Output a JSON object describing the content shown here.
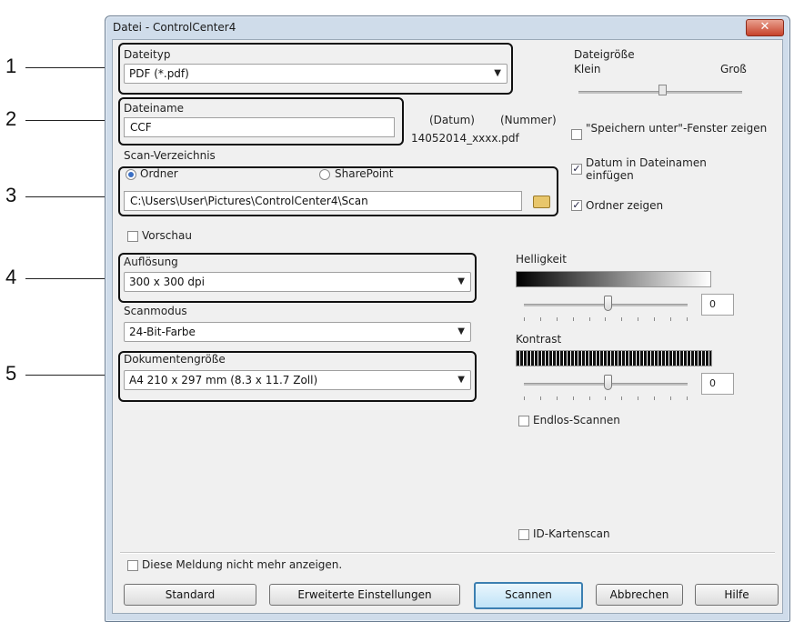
{
  "callouts": [
    "1",
    "2",
    "3",
    "4",
    "5"
  ],
  "window": {
    "title": "Datei - ControlCenter4",
    "close_glyph": "✕"
  },
  "file_type": {
    "label": "Dateityp",
    "value": "PDF (*.pdf)"
  },
  "file_size": {
    "label": "Dateigröße",
    "min_label": "Klein",
    "max_label": "Groß",
    "level": 0.6
  },
  "file_name": {
    "label": "Dateiname",
    "value": "CCF",
    "date_label": "(Datum)",
    "number_label": "(Nummer)",
    "example": "14052014_xxxx.pdf"
  },
  "scan_dir": {
    "label": "Scan-Verzeichnis",
    "folder_option": "Ordner",
    "sharepoint_option": "SharePoint",
    "path": "C:\\Users\\User\\Pictures\\ControlCenter4\\Scan"
  },
  "options": {
    "save_as": "\"Speichern unter\"-Fenster zeigen",
    "date_in_name": "Datum in Dateinamen einfügen",
    "show_folder": "Ordner zeigen"
  },
  "preview": {
    "label": "Vorschau"
  },
  "resolution": {
    "label": "Auflösung",
    "value": "300 x 300 dpi"
  },
  "scan_mode": {
    "label": "Scanmodus",
    "value": "24-Bit-Farbe"
  },
  "doc_size": {
    "label": "Dokumentengröße",
    "value": "A4 210 x 297 mm (8.3 x 11.7 Zoll)"
  },
  "brightness": {
    "label": "Helligkeit",
    "value": "0"
  },
  "contrast": {
    "label": "Kontrast",
    "value": "0"
  },
  "continuous_scan": {
    "label": "Endlos-Scannen"
  },
  "id_card_scan": {
    "label": "ID-Kartenscan"
  },
  "dont_show": {
    "label": "Diese Meldung nicht mehr anzeigen."
  },
  "buttons": {
    "standard": "Standard",
    "advanced": "Erweiterte Einstellungen",
    "scan": "Scannen",
    "cancel": "Abbrechen",
    "help": "Hilfe"
  },
  "colors": {
    "accent": "#3c7fb1",
    "titlebar": "#cfdcea",
    "close": "#c7432b"
  }
}
